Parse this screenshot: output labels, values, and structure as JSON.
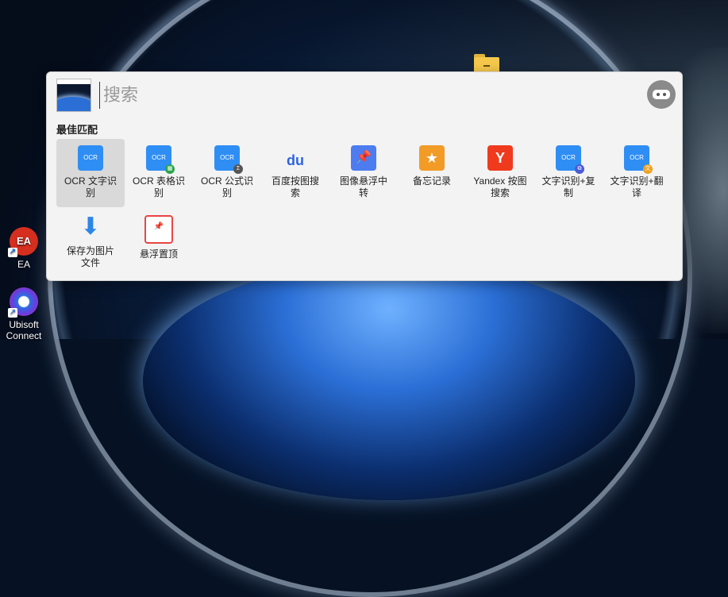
{
  "search": {
    "placeholder": "搜索"
  },
  "section": {
    "title": "最佳匹配"
  },
  "items": [
    {
      "label": "OCR 文字识别",
      "icon_text": "OCR",
      "icon": "ocr-text-icon"
    },
    {
      "label": "OCR 表格识别",
      "icon_text": "OCR",
      "icon": "ocr-table-icon"
    },
    {
      "label": "OCR 公式识别",
      "icon_text": "OCR",
      "icon": "ocr-formula-icon"
    },
    {
      "label": "百度按图搜索",
      "icon_text": "du",
      "icon": "baidu-icon"
    },
    {
      "label": "图像悬浮中转",
      "icon_text": "📌",
      "icon": "pin-icon"
    },
    {
      "label": "备忘记录",
      "icon_text": "★",
      "icon": "memo-icon"
    },
    {
      "label": "Yandex 按图搜索",
      "icon_text": "Y",
      "icon": "yandex-icon"
    },
    {
      "label": "文字识别+复制",
      "icon_text": "OCR",
      "icon": "ocr-copy-icon"
    },
    {
      "label": "文字识别+翻译",
      "icon_text": "OCR",
      "icon": "ocr-translate-icon"
    },
    {
      "label": "保存为图片文件",
      "icon_text": "⬇",
      "icon": "download-icon"
    },
    {
      "label": "悬浮置顶",
      "icon_text": "📌",
      "icon": "pin-top-icon"
    }
  ],
  "desktop": [
    {
      "label": "EA",
      "icon_text": "EA"
    },
    {
      "label": "Ubisoft Connect",
      "icon_text": ""
    }
  ],
  "colors": {
    "accent": "#2f8ef4",
    "selected": "#d9d9d9"
  }
}
